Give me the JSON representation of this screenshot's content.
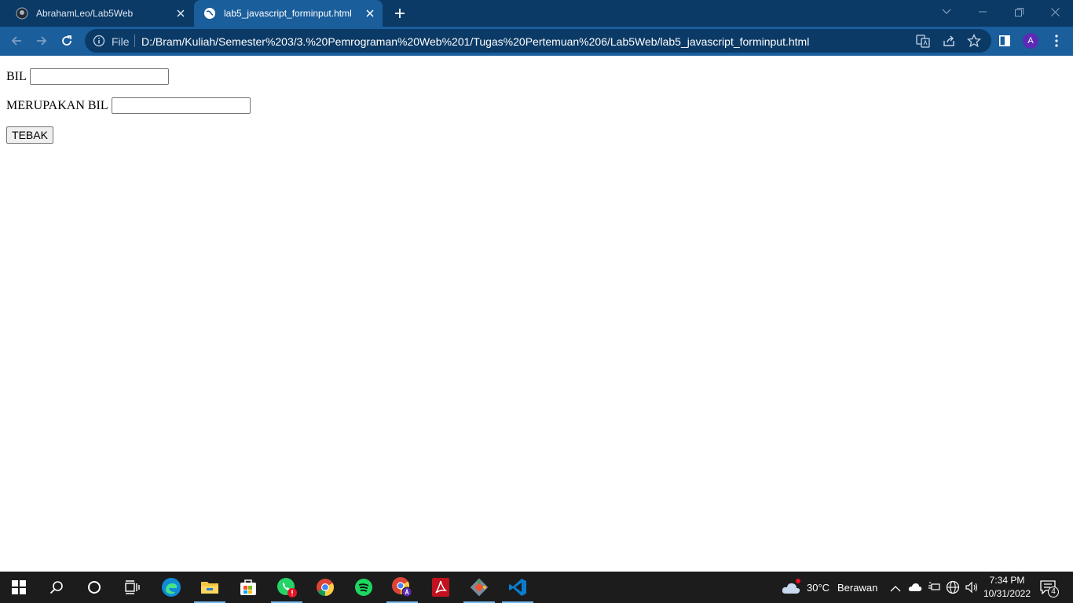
{
  "browser": {
    "tabs": [
      {
        "title": "AbrahamLeo/Lab5Web",
        "active": false,
        "icon": "github-icon"
      },
      {
        "title": "lab5_javascript_forminput.html",
        "active": true,
        "icon": "globe-icon"
      }
    ],
    "omnibox": {
      "scheme_label": "File",
      "url": "D:/Bram/Kuliah/Semester%203/3.%20Pemrograman%20Web%201/Tugas%20Pertemuan%206/Lab5Web/lab5_javascript_forminput.html"
    },
    "profile_initial": "A"
  },
  "form": {
    "bil_label": "BIL",
    "bil_value": "",
    "result_label": "MERUPAKAN BIL",
    "result_value": "",
    "submit_label": "TEBAK"
  },
  "taskbar": {
    "apps": [
      "edge",
      "file-explorer",
      "microsoft-store",
      "whatsapp",
      "chrome",
      "spotify",
      "chrome-profile",
      "acrobat",
      "git",
      "vscode"
    ],
    "weather_temp": "30°C",
    "weather_desc": "Berawan",
    "time": "7:34 PM",
    "date": "10/31/2022",
    "notification_count": "4"
  }
}
